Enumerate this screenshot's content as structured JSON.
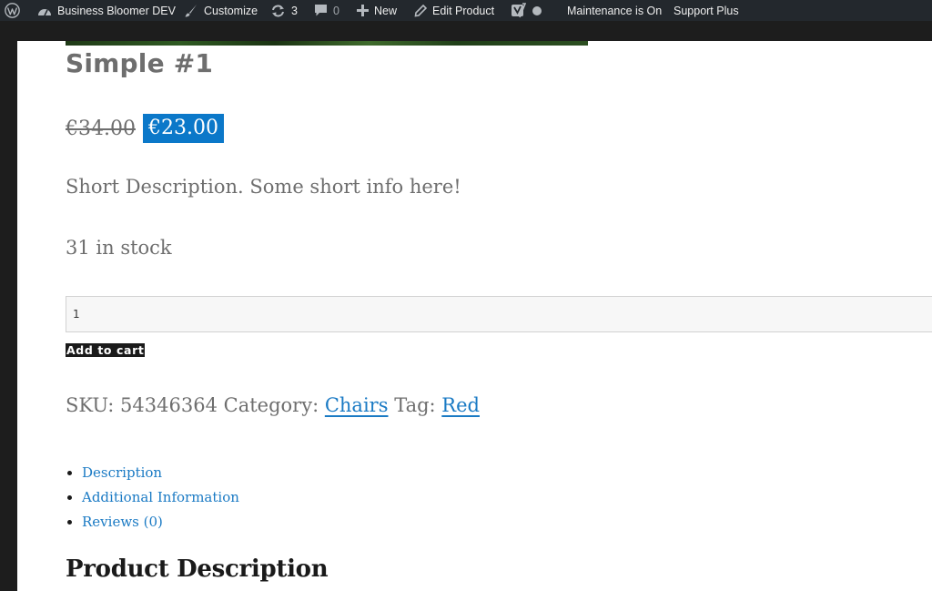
{
  "adminbar": {
    "site_name": "Business Bloomer DEV",
    "customize": "Customize",
    "updates_count": "3",
    "comments_count": "0",
    "new_label": "New",
    "edit_product": "Edit Product",
    "maintenance": "Maintenance is On",
    "support": "Support Plus",
    "icons": [
      "wordpress-logo-icon",
      "dashboard-icon",
      "brush-icon",
      "updates-icon",
      "comment-icon",
      "plus-icon",
      "pencil-icon",
      "yoast-icon",
      "status-dot-icon"
    ]
  },
  "product": {
    "title": "Simple #1",
    "price_old": "€34.00",
    "price_new": "€23.00",
    "short_description": "Short Description. Some short info here!",
    "stock": "31 in stock",
    "quantity": "1",
    "add_to_cart": "Add to cart",
    "sku_label": "SKU:",
    "sku": "54346364",
    "category_label": "Category:",
    "category": "Chairs",
    "tag_label": "Tag:",
    "tag": "Red"
  },
  "tabs": [
    {
      "label": "Description"
    },
    {
      "label": "Additional Information"
    },
    {
      "label": "Reviews (0)"
    }
  ],
  "section": {
    "heading": "Product Description"
  },
  "colors": {
    "adminbar_bg": "#23282d",
    "sale_price_bg": "#0b78c9",
    "link": "#1a7ac4",
    "text": "#6e6e6e"
  }
}
